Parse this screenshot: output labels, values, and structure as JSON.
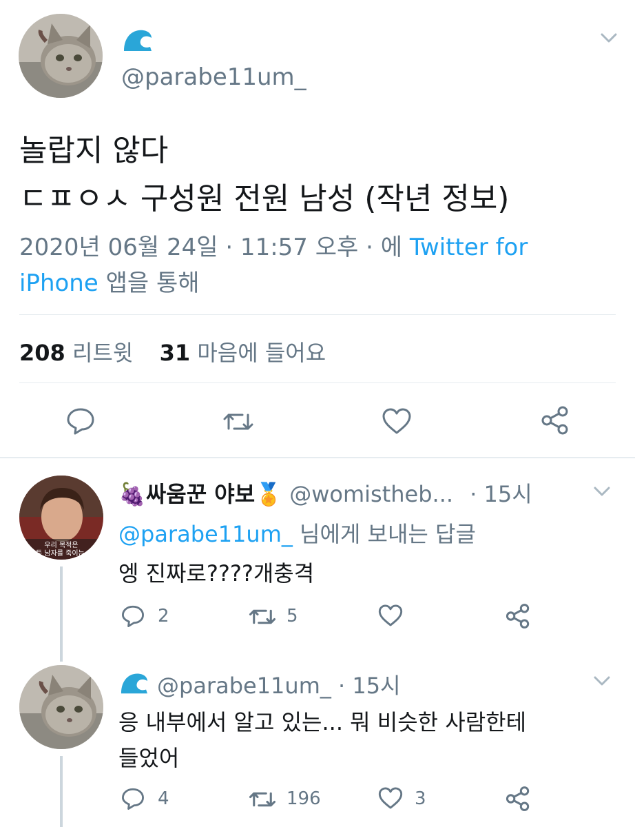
{
  "main_tweet": {
    "handle": "@parabe11um_",
    "text_line1": "놀랍지 않다",
    "text_line2": "ㄷㅍㅇㅅ 구성원 전원 남성 (작년 정보)",
    "meta_date": "2020년 06월 24일 · 11:57 오후 · 에",
    "meta_source_a": "Twitter for",
    "meta_source_b": "iPhone",
    "meta_suffix": "앱을 통해",
    "retweet_count": "208",
    "retweet_label": "리트윗",
    "like_count": "31",
    "like_label": "마음에 들어요"
  },
  "replies": [
    {
      "name": "싸움꾼 야보",
      "emoji_left": "🍇",
      "emoji_right": "🏅",
      "handle": "@womistheb...",
      "time": "· 15시",
      "reply_to_handle": "@parabe11um_",
      "reply_to_suffix": "님에게 보내는 답글",
      "text": "엥 진짜로????개충격",
      "avatar_caption_1": "우리 목적은",
      "avatar_caption_2": "모든 남자를 죽이는 거",
      "reply_count": "2",
      "retweet_count": "5",
      "like_count": ""
    },
    {
      "handle": "@parabe11um_",
      "time": "· 15시",
      "text_line1": "응 내부에서 알고 있는... 뭐 비슷한 사람한테",
      "text_line2": "들었어",
      "reply_count": "4",
      "retweet_count": "196",
      "like_count": "3"
    }
  ],
  "colors": {
    "accent": "#1da1f2",
    "muted": "#657786",
    "divider": "#e6ecf0",
    "logo": "#2aa6d8"
  },
  "icons": [
    "reply-icon",
    "retweet-icon",
    "like-icon",
    "share-icon",
    "chevron-down-icon",
    "wave-logo-icon"
  ]
}
